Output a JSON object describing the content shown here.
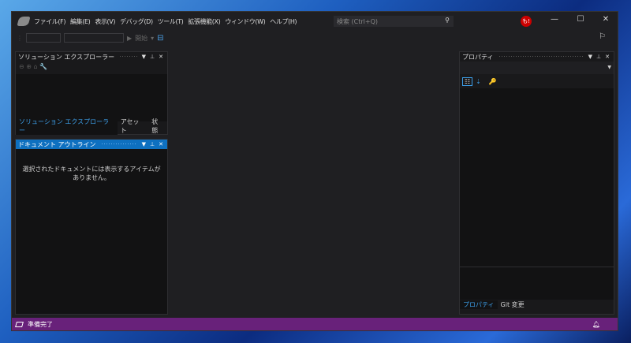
{
  "menu": [
    "ファイル(F)",
    "編集(E)",
    "表示(V)",
    "デバッグ(D)",
    "ツール(T)",
    "拡張機能(X)",
    "ウィンドウ(W)",
    "ヘルプ(H)"
  ],
  "search": {
    "placeholder": "検索 (Ctrl+Q)"
  },
  "avatar": "も!",
  "toolbar": {
    "start_label": "開始"
  },
  "solution_explorer": {
    "title": "ソリューション エクスプローラー",
    "tabs": [
      "ソリューション エクスプローラー",
      "アセット",
      "状態"
    ]
  },
  "document_outline": {
    "title": "ドキュメント アウトライン",
    "empty_message": "選択されたドキュメントには表示するアイテムがありません。"
  },
  "properties": {
    "title": "プロパティ",
    "tabs": [
      "プロパティ",
      "Git 変更"
    ]
  },
  "status": {
    "text": "準備完了"
  },
  "colors": {
    "accent": "#0e70c0",
    "status_bar": "#68217a"
  }
}
